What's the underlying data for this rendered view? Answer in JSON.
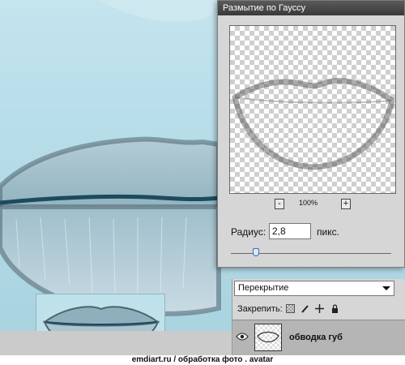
{
  "dialog": {
    "title": "Размытие по Гауссу",
    "zoom": {
      "minus": "-",
      "level": "100%",
      "plus": "+"
    },
    "radius": {
      "label": "Радиус:",
      "value": "2,8",
      "unit": "пикс."
    },
    "slider": {
      "value": 2.8
    }
  },
  "layers": {
    "blend_mode": "Перекрытие",
    "lock_label": "Закрепить:",
    "lock_icons": [
      "transparent-pixels-lock-icon",
      "brush-lock-icon",
      "move-lock-icon",
      "lock-all-icon"
    ],
    "layer_name": "обводка губ"
  },
  "caption": "emdiart.ru  / обработка фото . avatar"
}
